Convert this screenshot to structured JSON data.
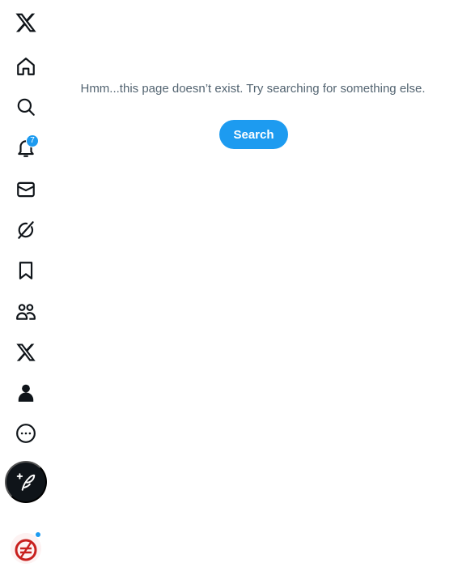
{
  "sidebar": {
    "items": [
      {
        "name": "x-logo",
        "icon": "x-logo-icon"
      },
      {
        "name": "home",
        "icon": "home-icon"
      },
      {
        "name": "explore",
        "icon": "search-icon"
      },
      {
        "name": "notifications",
        "icon": "bell-icon",
        "badge": "7"
      },
      {
        "name": "messages",
        "icon": "envelope-icon"
      },
      {
        "name": "grok",
        "icon": "grok-icon"
      },
      {
        "name": "bookmarks",
        "icon": "bookmark-icon"
      },
      {
        "name": "communities",
        "icon": "people-icon"
      },
      {
        "name": "premium",
        "icon": "x-logo-icon"
      },
      {
        "name": "profile",
        "icon": "person-icon"
      },
      {
        "name": "more",
        "icon": "more-circle-icon"
      }
    ],
    "post_button": {
      "icon": "feather-plus-icon"
    },
    "account": {
      "icon": "avatar-logo",
      "has_notification_dot": true
    }
  },
  "main": {
    "message": "Hmm...this page doesn’t exist. Try searching for something else.",
    "search_button_label": "Search"
  },
  "colors": {
    "accent": "#1d9bf0",
    "text_primary": "#0f1419",
    "text_secondary": "#536471",
    "background": "#ffffff"
  }
}
